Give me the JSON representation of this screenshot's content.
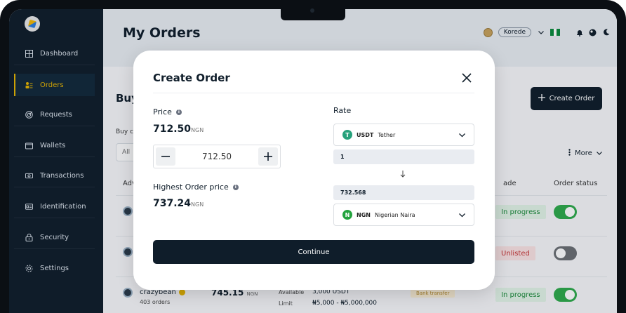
{
  "sidebar": {
    "items": [
      {
        "label": "Dashboard",
        "icon": "grid-icon"
      },
      {
        "label": "Orders",
        "icon": "list-icon"
      },
      {
        "label": "Requests",
        "icon": "target-icon"
      },
      {
        "label": "Wallets",
        "icon": "wallet-icon"
      },
      {
        "label": "Transactions",
        "icon": "cash-icon"
      },
      {
        "label": "Identification",
        "icon": "id-card-icon"
      },
      {
        "label": "Security",
        "icon": "lock-icon"
      },
      {
        "label": "Settings",
        "icon": "gear-icon"
      }
    ],
    "active": "Orders"
  },
  "header": {
    "title": "My Orders",
    "username": "Korede"
  },
  "background": {
    "section_title": "Buy",
    "sub_label": "Buy c",
    "filter_placeholder": "All",
    "create_order_label": "Create Order",
    "more_label": "More",
    "columns": {
      "advertiser": "Adv",
      "trade": "ade",
      "order_status": "Order status"
    },
    "rows": [
      {
        "status": "In progress",
        "status_color": "#1b8a3a",
        "enabled": true
      },
      {
        "status": "Unlisted",
        "status_color": "#c83434",
        "enabled": false
      },
      {
        "status": "In progress",
        "status_color": "#1b8a3a",
        "enabled": true
      }
    ],
    "last_row": {
      "trader": "crazybean",
      "orders": "403 orders",
      "price": "745.15",
      "price_unit": "NGN",
      "available_label": "Available",
      "available_value": "3,000 USDT",
      "limit_label": "Limit",
      "limit_value": "₦5,000 - ₦5,000,000",
      "payment": "Bank transfer"
    }
  },
  "modal": {
    "title": "Create Order",
    "price_label": "Price",
    "price_value": "712.50",
    "price_unit": "NGN",
    "stepper_value": "712.50",
    "highest_label": "Highest Order price",
    "highest_value": "737.24",
    "highest_unit": "NGN",
    "rate_label": "Rate",
    "from_currency": {
      "code": "USDT",
      "name": "Tether"
    },
    "from_amount": "1",
    "to_amount": "732.568",
    "to_currency": {
      "code": "NGN",
      "name": "Nigerian Naira"
    },
    "continue_label": "Continue"
  },
  "colors": {
    "sidebar_bg": "#0f1d2a",
    "accent": "#e6b400",
    "primary_button": "#0f1d2a",
    "toggle_on": "#2eaa4a",
    "usdt": "#26a17b"
  }
}
